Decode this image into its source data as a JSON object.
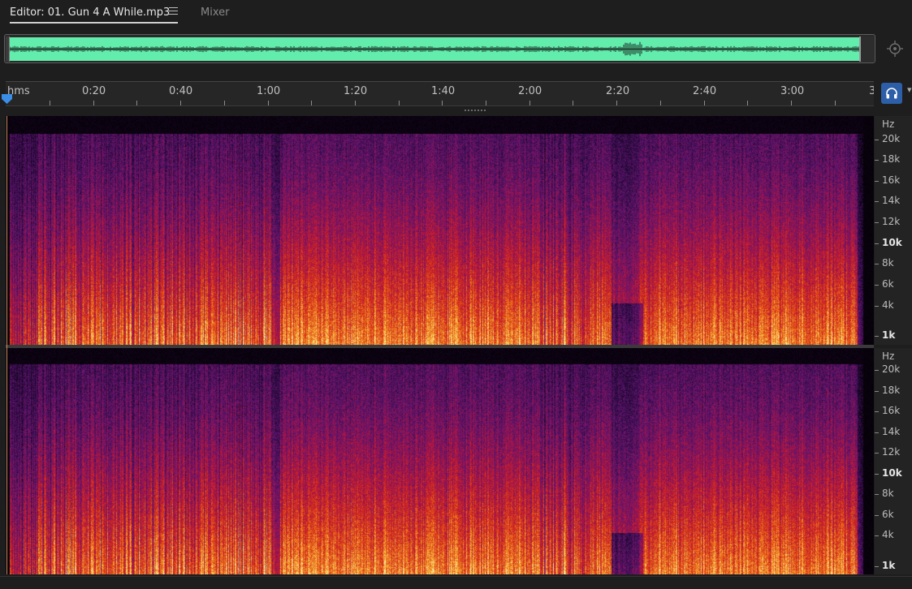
{
  "tabs": {
    "editor_label": "Editor: 01. Gun 4 A While.mp3",
    "mixer_label": "Mixer"
  },
  "ruler": {
    "unit_label": "hms",
    "time_labels": [
      "0:20",
      "0:40",
      "1:00",
      "1:20",
      "1:40",
      "2:00",
      "2:20",
      "2:40",
      "3:00"
    ],
    "edge_label": "3"
  },
  "frequency_scale": {
    "unit": "Hz",
    "labels": [
      "20k",
      "18k",
      "16k",
      "14k",
      "12k",
      "10k",
      "8k",
      "6k",
      "4k",
      "1k"
    ],
    "bold_labels": [
      "10k",
      "1k"
    ]
  },
  "overview": {
    "waveform_color": "#62edad"
  },
  "playback": {
    "headphone_active": true
  },
  "colors": {
    "background": "#1e1e1e",
    "accent": "#2d5ea8",
    "playhead": "#3a8ee6"
  },
  "icons": {
    "menu": "hamburger-menu-icon",
    "zoom": "zoom-target-icon",
    "headphone": "headphone-icon",
    "playhead": "playhead-marker-icon"
  }
}
